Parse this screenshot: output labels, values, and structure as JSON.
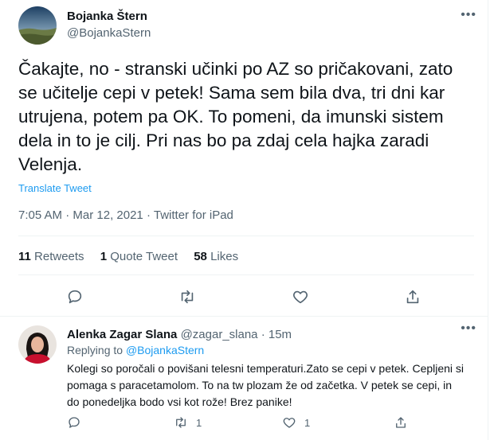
{
  "tweet": {
    "display_name": "Bojanka Štern",
    "handle": "@BojankaStern",
    "more_icon": "more-horizontal-icon",
    "text": "Čakajte, no - stranski učinki po AZ so pričakovani, zato se učitelje cepi v petek! Sama sem bila dva, tri dni kar utrujena, potem pa OK. To pomeni, da imunski sistem dela in to je cilj. Pri nas bo pa zdaj cela hajka zaradi Velenja.",
    "translate_label": "Translate Tweet",
    "time": "7:05 AM",
    "separator": "·",
    "date": "Mar 12, 2021",
    "source": "Twitter for iPad",
    "retweets_count": "11",
    "retweets_label": "Retweets",
    "quotes_count": "1",
    "quotes_label": "Quote Tweet",
    "likes_count": "58",
    "likes_label": "Likes"
  },
  "reply": {
    "display_name": "Alenka Zagar Slana",
    "handle": "@zagar_slana",
    "separator": "·",
    "time_ago": "15m",
    "replying_prefix": "Replying to",
    "replying_to": "@BojankaStern",
    "text": "Kolegi so poročali o povišani telesni temperaturi.Zato se cepi v petek. Cepljeni si pomaga s paracetamolom. To na tw plozam že od začetka. V petek se cepi, in do ponedeljka bodo vsi kot rože! Brez panike!",
    "retweets_count": "1",
    "likes_count": "1"
  },
  "colors": {
    "text": "#0f1419",
    "secondary": "#536471",
    "link": "#1d9bf0",
    "divider": "#eff3f4"
  }
}
